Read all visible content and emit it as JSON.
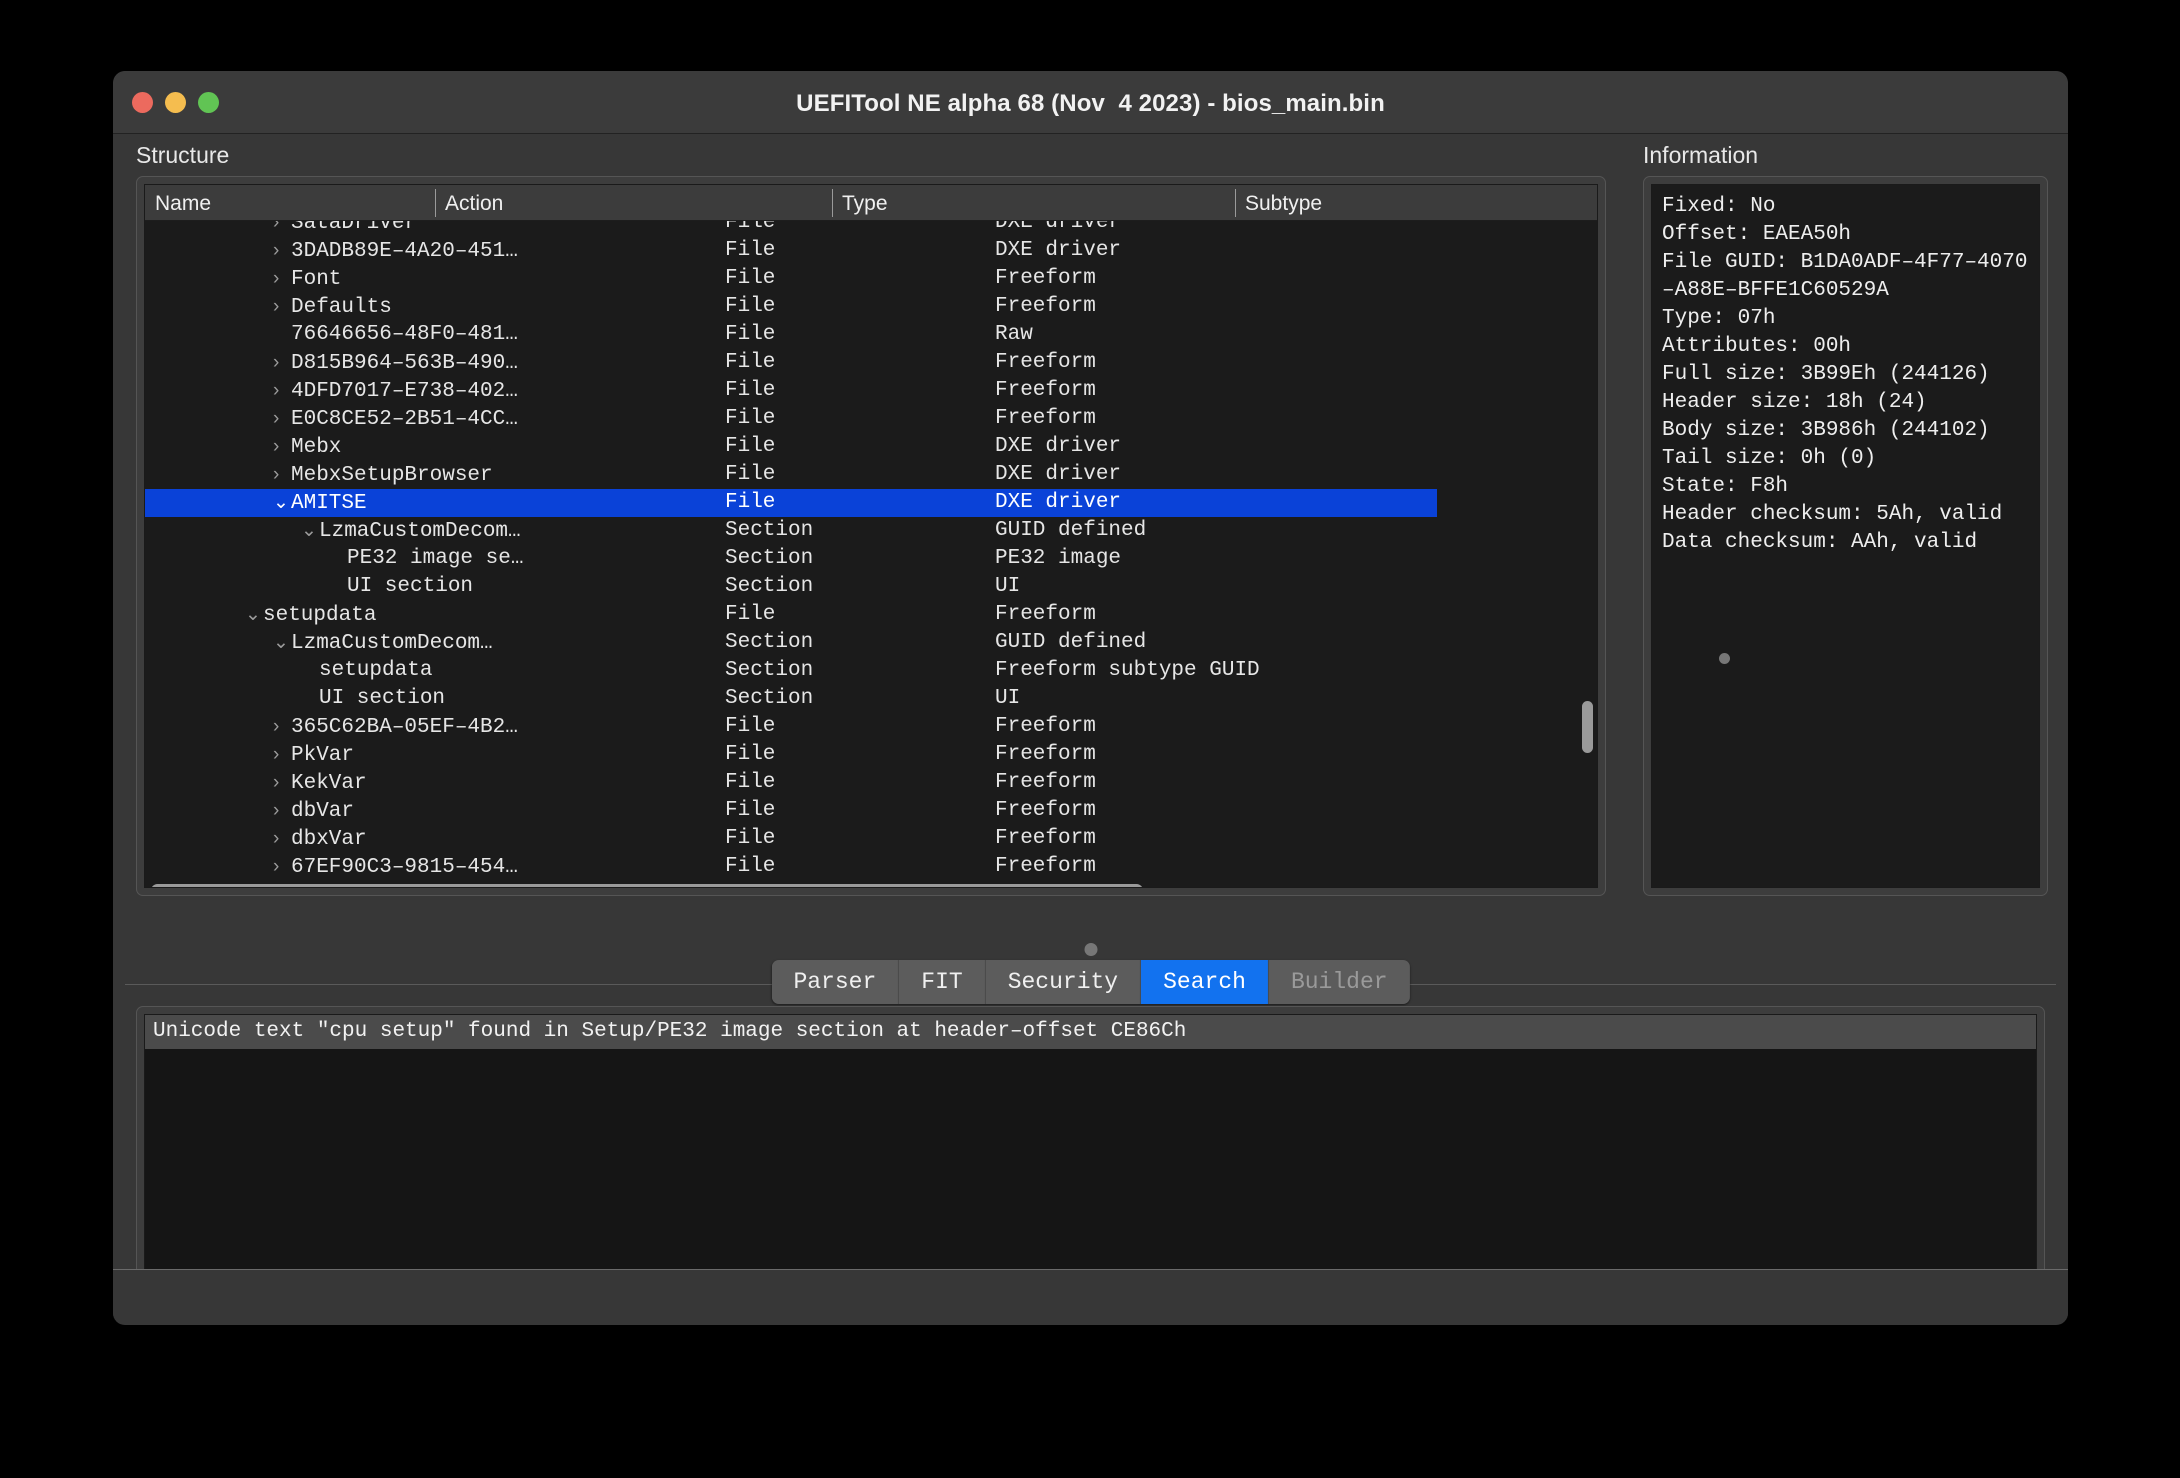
{
  "window": {
    "title": "UEFITool NE alpha 68 (Nov  4 2023) - bios_main.bin",
    "traffic_lights": {
      "close": "close-button",
      "minimize": "minimize-button",
      "zoom": "zoom-button",
      "close_color": "#ec6a5e",
      "minimize_color": "#f5bd4f",
      "zoom_color": "#61c454"
    }
  },
  "structure": {
    "label": "Structure",
    "columns": [
      "Name",
      "Action",
      "Type",
      "Subtype"
    ],
    "selection_color": "#0a42d8",
    "rows": [
      {
        "name": "SataDriver",
        "indent": 1,
        "chevron": "collapsed",
        "action": "",
        "type": "File",
        "subtype": "DXE driver",
        "selected": false
      },
      {
        "name": "3DADB89E–4A20–451…",
        "indent": 1,
        "chevron": "collapsed",
        "action": "",
        "type": "File",
        "subtype": "DXE driver",
        "selected": false
      },
      {
        "name": "Font",
        "indent": 1,
        "chevron": "collapsed",
        "action": "",
        "type": "File",
        "subtype": "Freeform",
        "selected": false
      },
      {
        "name": "Defaults",
        "indent": 1,
        "chevron": "collapsed",
        "action": "",
        "type": "File",
        "subtype": "Freeform",
        "selected": false
      },
      {
        "name": "76646656–48F0–481…",
        "indent": 1,
        "chevron": "none",
        "action": "",
        "type": "File",
        "subtype": "Raw",
        "selected": false
      },
      {
        "name": "D815B964–563B–490…",
        "indent": 1,
        "chevron": "collapsed",
        "action": "",
        "type": "File",
        "subtype": "Freeform",
        "selected": false
      },
      {
        "name": "4DFD7017–E738–402…",
        "indent": 1,
        "chevron": "collapsed",
        "action": "",
        "type": "File",
        "subtype": "Freeform",
        "selected": false
      },
      {
        "name": "E0C8CE52–2B51–4CC…",
        "indent": 1,
        "chevron": "collapsed",
        "action": "",
        "type": "File",
        "subtype": "Freeform",
        "selected": false
      },
      {
        "name": "Mebx",
        "indent": 1,
        "chevron": "collapsed",
        "action": "",
        "type": "File",
        "subtype": "DXE driver",
        "selected": false
      },
      {
        "name": "MebxSetupBrowser",
        "indent": 1,
        "chevron": "collapsed",
        "action": "",
        "type": "File",
        "subtype": "DXE driver",
        "selected": false
      },
      {
        "name": "AMITSE",
        "indent": 1,
        "chevron": "expanded",
        "action": "",
        "type": "File",
        "subtype": "DXE driver",
        "selected": true
      },
      {
        "name": "LzmaCustomDecom…",
        "indent": 2,
        "chevron": "expanded",
        "action": "",
        "type": "Section",
        "subtype": "GUID defined",
        "selected": false
      },
      {
        "name": "PE32 image se…",
        "indent": 3,
        "chevron": "none",
        "action": "",
        "type": "Section",
        "subtype": "PE32 image",
        "selected": false
      },
      {
        "name": "UI section",
        "indent": 3,
        "chevron": "none",
        "action": "",
        "type": "Section",
        "subtype": "UI",
        "selected": false
      },
      {
        "name": "setupdata",
        "indent": 0,
        "chevron": "expanded",
        "action": "",
        "type": "File",
        "subtype": "Freeform",
        "selected": false
      },
      {
        "name": "LzmaCustomDecom…",
        "indent": 1,
        "chevron": "expanded",
        "action": "",
        "type": "Section",
        "subtype": "GUID defined",
        "selected": false
      },
      {
        "name": "setupdata",
        "indent": 2,
        "chevron": "none",
        "action": "",
        "type": "Section",
        "subtype": "Freeform subtype GUID",
        "selected": false
      },
      {
        "name": "UI section",
        "indent": 2,
        "chevron": "none",
        "action": "",
        "type": "Section",
        "subtype": "UI",
        "selected": false
      },
      {
        "name": "365C62BA–05EF–4B2…",
        "indent": 1,
        "chevron": "collapsed",
        "action": "",
        "type": "File",
        "subtype": "Freeform",
        "selected": false
      },
      {
        "name": "PkVar",
        "indent": 1,
        "chevron": "collapsed",
        "action": "",
        "type": "File",
        "subtype": "Freeform",
        "selected": false
      },
      {
        "name": "KekVar",
        "indent": 1,
        "chevron": "collapsed",
        "action": "",
        "type": "File",
        "subtype": "Freeform",
        "selected": false
      },
      {
        "name": "dbVar",
        "indent": 1,
        "chevron": "collapsed",
        "action": "",
        "type": "File",
        "subtype": "Freeform",
        "selected": false
      },
      {
        "name": "dbxVar",
        "indent": 1,
        "chevron": "collapsed",
        "action": "",
        "type": "File",
        "subtype": "Freeform",
        "selected": false
      },
      {
        "name": "67EF90C3–9815–454…",
        "indent": 1,
        "chevron": "collapsed",
        "action": "",
        "type": "File",
        "subtype": "Freeform",
        "selected": false
      }
    ]
  },
  "information": {
    "label": "Information",
    "text": "Fixed: No\nOffset: EAEA50h\nFile GUID: B1DA0ADF–4F77–4070–A88E–BFFE1C60529A\nType: 07h\nAttributes: 00h\nFull size: 3B99Eh (244126)\nHeader size: 18h (24)\nBody size: 3B986h (244102)\nTail size: 0h (0)\nState: F8h\nHeader checksum: 5Ah, valid\nData checksum: AAh, valid"
  },
  "tabs": {
    "items": [
      {
        "label": "Parser",
        "active": false,
        "disabled": false
      },
      {
        "label": "FIT",
        "active": false,
        "disabled": false
      },
      {
        "label": "Security",
        "active": false,
        "disabled": false
      },
      {
        "label": "Search",
        "active": true,
        "disabled": false
      },
      {
        "label": "Builder",
        "active": false,
        "disabled": true
      }
    ],
    "active_color": "#1272ef"
  },
  "results": {
    "message": "Unicode text \"cpu setup\" found in Setup/PE32 image section at header–offset CE86Ch"
  }
}
